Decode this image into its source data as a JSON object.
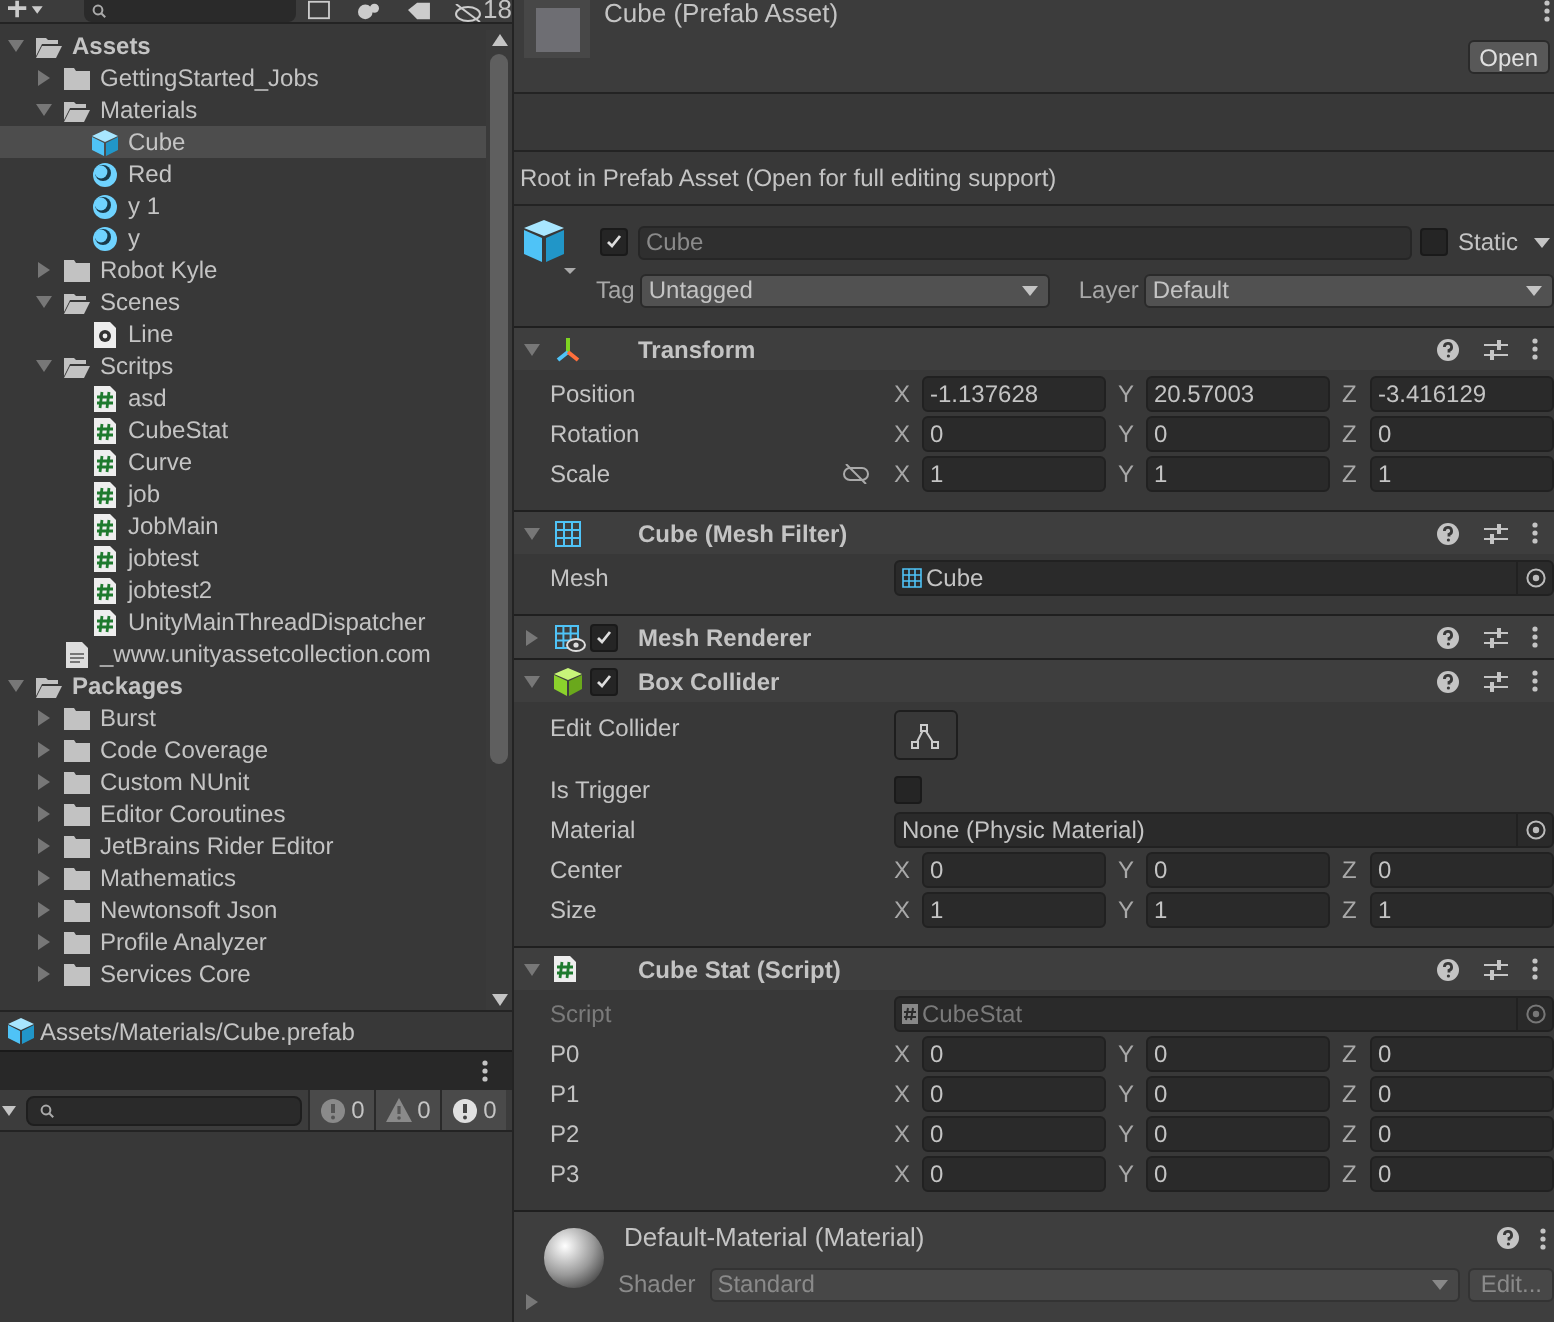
{
  "project": {
    "toolbar": {
      "hidden_count": "18"
    },
    "tree": [
      {
        "label": "Assets",
        "kind": "folder",
        "bold": true,
        "expanded": true,
        "selected": false,
        "children": [
          {
            "label": "GettingStarted_Jobs",
            "kind": "folder",
            "expanded": false,
            "selected": false
          },
          {
            "label": "Materials",
            "kind": "folder",
            "expanded": true,
            "selected": false,
            "children": [
              {
                "label": "Cube",
                "kind": "prefab",
                "selected": true
              },
              {
                "label": "Red",
                "kind": "material",
                "selected": false
              },
              {
                "label": "y 1",
                "kind": "material",
                "selected": false
              },
              {
                "label": "y",
                "kind": "material",
                "selected": false
              }
            ]
          },
          {
            "label": "Robot Kyle",
            "kind": "folder",
            "expanded": false,
            "selected": false
          },
          {
            "label": "Scenes",
            "kind": "folder",
            "expanded": true,
            "selected": false,
            "children": [
              {
                "label": "Line",
                "kind": "scene",
                "selected": false
              }
            ]
          },
          {
            "label": "Scritps",
            "kind": "folder",
            "expanded": true,
            "selected": false,
            "children": [
              {
                "label": "asd",
                "kind": "script",
                "selected": false
              },
              {
                "label": "CubeStat",
                "kind": "script",
                "selected": false
              },
              {
                "label": "Curve",
                "kind": "script",
                "selected": false
              },
              {
                "label": "job",
                "kind": "script",
                "selected": false
              },
              {
                "label": "JobMain",
                "kind": "script",
                "selected": false
              },
              {
                "label": "jobtest",
                "kind": "script",
                "selected": false
              },
              {
                "label": "jobtest2",
                "kind": "script",
                "selected": false
              },
              {
                "label": "UnityMainThreadDispatcher",
                "kind": "script",
                "selected": false
              }
            ]
          },
          {
            "label": "_www.unityassetcollection.com",
            "kind": "text",
            "selected": false
          }
        ]
      },
      {
        "label": "Packages",
        "kind": "folder",
        "bold": true,
        "expanded": true,
        "selected": false,
        "children": [
          {
            "label": "Burst",
            "kind": "folder",
            "expanded": false,
            "selected": false
          },
          {
            "label": "Code Coverage",
            "kind": "folder",
            "expanded": false,
            "selected": false
          },
          {
            "label": "Custom NUnit",
            "kind": "folder",
            "expanded": false,
            "selected": false
          },
          {
            "label": "Editor Coroutines",
            "kind": "folder",
            "expanded": false,
            "selected": false
          },
          {
            "label": "JetBrains Rider Editor",
            "kind": "folder",
            "expanded": false,
            "selected": false
          },
          {
            "label": "Mathematics",
            "kind": "folder",
            "expanded": false,
            "selected": false
          },
          {
            "label": "Newtonsoft Json",
            "kind": "folder",
            "expanded": false,
            "selected": false
          },
          {
            "label": "Profile Analyzer",
            "kind": "folder",
            "expanded": false,
            "selected": false
          },
          {
            "label": "Services Core",
            "kind": "folder",
            "expanded": false,
            "selected": false
          }
        ]
      }
    ],
    "path": "Assets/Materials/Cube.prefab"
  },
  "console": {
    "counts": [
      {
        "kind": "info",
        "count": "0"
      },
      {
        "kind": "warning",
        "count": "0"
      },
      {
        "kind": "error",
        "count": "0"
      }
    ]
  },
  "inspector": {
    "title": "Cube (Prefab Asset)",
    "open_button": "Open",
    "notice": "Root in Prefab Asset (Open for full editing support)",
    "game_object": {
      "active": true,
      "name": "Cube",
      "static": false,
      "static_label": "Static",
      "tag_label": "Tag",
      "tag": "Untagged",
      "layer_label": "Layer",
      "layer": "Default"
    },
    "components": [
      {
        "kind": "transform",
        "title": "Transform",
        "expanded": true,
        "rows": [
          {
            "kind": "vector3",
            "label": "Position",
            "fields": [
              {
                "axis": "X",
                "value": "-1.137628"
              },
              {
                "axis": "Y",
                "value": "20.57003"
              },
              {
                "axis": "Z",
                "value": "-3.416129"
              }
            ]
          },
          {
            "kind": "vector3",
            "label": "Rotation",
            "fields": [
              {
                "axis": "X",
                "value": "0"
              },
              {
                "axis": "Y",
                "value": "0"
              },
              {
                "axis": "Z",
                "value": "0"
              }
            ]
          },
          {
            "kind": "vector3",
            "label": "Scale",
            "proportions_locked": false,
            "fields": [
              {
                "axis": "X",
                "value": "1"
              },
              {
                "axis": "Y",
                "value": "1"
              },
              {
                "axis": "Z",
                "value": "1"
              }
            ]
          }
        ]
      },
      {
        "kind": "mesh_filter",
        "title": "Cube (Mesh Filter)",
        "expanded": true,
        "rows": [
          {
            "kind": "object",
            "label": "Mesh",
            "value": "Cube",
            "disabled": false
          }
        ]
      },
      {
        "kind": "mesh_renderer",
        "title": "Mesh Renderer",
        "expanded": false,
        "enabled": true
      },
      {
        "kind": "box_collider",
        "title": "Box Collider",
        "expanded": true,
        "enabled": true,
        "rows": [
          {
            "kind": "edit_button",
            "label": "Edit Collider"
          },
          {
            "kind": "checkbox",
            "label": "Is Trigger",
            "checked": false
          },
          {
            "kind": "object",
            "label": "Material",
            "value": "None (Physic Material)",
            "disabled": false
          },
          {
            "kind": "vector3",
            "label": "Center",
            "fields": [
              {
                "axis": "X",
                "value": "0"
              },
              {
                "axis": "Y",
                "value": "0"
              },
              {
                "axis": "Z",
                "value": "0"
              }
            ]
          },
          {
            "kind": "vector3",
            "label": "Size",
            "fields": [
              {
                "axis": "X",
                "value": "1"
              },
              {
                "axis": "Y",
                "value": "1"
              },
              {
                "axis": "Z",
                "value": "1"
              }
            ]
          }
        ]
      },
      {
        "kind": "script",
        "title": "Cube Stat (Script)",
        "expanded": true,
        "rows": [
          {
            "kind": "object",
            "label": "Script",
            "value": "CubeStat",
            "disabled": true
          },
          {
            "kind": "vector3",
            "label": "P0",
            "fields": [
              {
                "axis": "X",
                "value": "0"
              },
              {
                "axis": "Y",
                "value": "0"
              },
              {
                "axis": "Z",
                "value": "0"
              }
            ]
          },
          {
            "kind": "vector3",
            "label": "P1",
            "fields": [
              {
                "axis": "X",
                "value": "0"
              },
              {
                "axis": "Y",
                "value": "0"
              },
              {
                "axis": "Z",
                "value": "0"
              }
            ]
          },
          {
            "kind": "vector3",
            "label": "P2",
            "fields": [
              {
                "axis": "X",
                "value": "0"
              },
              {
                "axis": "Y",
                "value": "0"
              },
              {
                "axis": "Z",
                "value": "0"
              }
            ]
          },
          {
            "kind": "vector3",
            "label": "P3",
            "fields": [
              {
                "axis": "X",
                "value": "0"
              },
              {
                "axis": "Y",
                "value": "0"
              },
              {
                "axis": "Z",
                "value": "0"
              }
            ]
          }
        ]
      }
    ],
    "material": {
      "title": "Default-Material (Material)",
      "shader_label": "Shader",
      "shader": "Standard",
      "edit_button": "Edit...",
      "expanded": false
    }
  }
}
